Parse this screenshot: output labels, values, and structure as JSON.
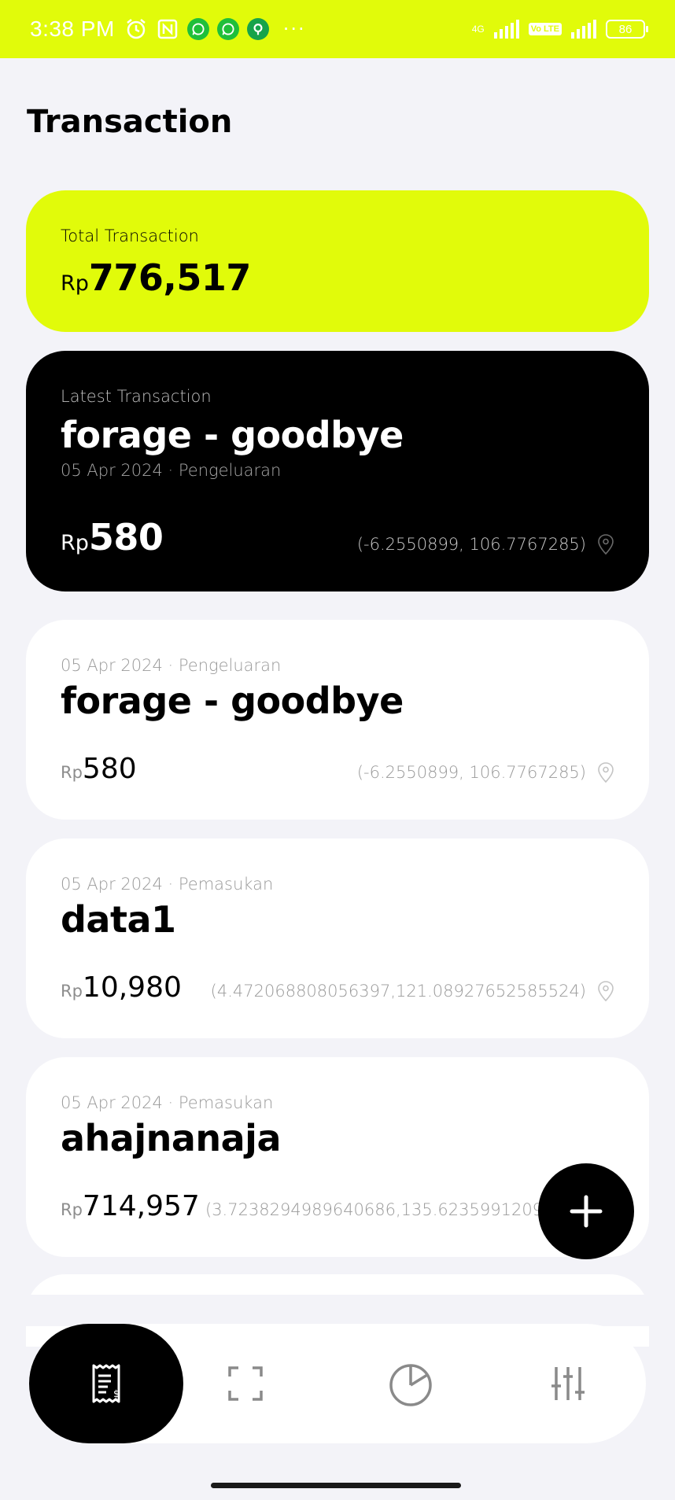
{
  "status_bar": {
    "time": "3:38 PM",
    "icons": [
      "alarm-icon",
      "nfc-icon",
      "whatsapp-icon",
      "whatsapp-icon",
      "location-app-icon",
      "more-dots-icon"
    ],
    "network": "4G",
    "volte": "Vo LTE",
    "battery": "86"
  },
  "page": {
    "title": "Transaction"
  },
  "total": {
    "label": "Total Transaction",
    "currency": "Rp",
    "amount": "776,517",
    "color": "#e1fb0a"
  },
  "latest": {
    "label": "Latest Transaction",
    "title": "forage - goodbye",
    "meta": "05 Apr 2024 · Pengeluaran",
    "currency": "Rp",
    "amount": "580",
    "coords": "(-6.2550899, 106.7767285)"
  },
  "transactions": [
    {
      "meta": "05 Apr 2024 · Pengeluaran",
      "title": "forage - goodbye",
      "currency": "Rp",
      "amount": "580",
      "coords": "(-6.2550899, 106.7767285)"
    },
    {
      "meta": "05 Apr 2024 · Pemasukan",
      "title": "data1",
      "currency": "Rp",
      "amount": "10,980",
      "coords": "(4.472068808056397,121.08927652585524)"
    },
    {
      "meta": "05 Apr 2024 · Pemasukan",
      "title": "ahajnanaja",
      "currency": "Rp",
      "amount": "714,957",
      "coords": "(3.7238294989640686,135.6235991209"
    }
  ],
  "fab": {
    "icon": "plus-icon"
  },
  "nav": [
    {
      "name": "transactions",
      "icon": "receipt-icon",
      "active": true
    },
    {
      "name": "scan",
      "icon": "scan-icon",
      "active": false
    },
    {
      "name": "statistics",
      "icon": "pie-chart-icon",
      "active": false
    },
    {
      "name": "settings",
      "icon": "sliders-icon",
      "active": false
    }
  ]
}
